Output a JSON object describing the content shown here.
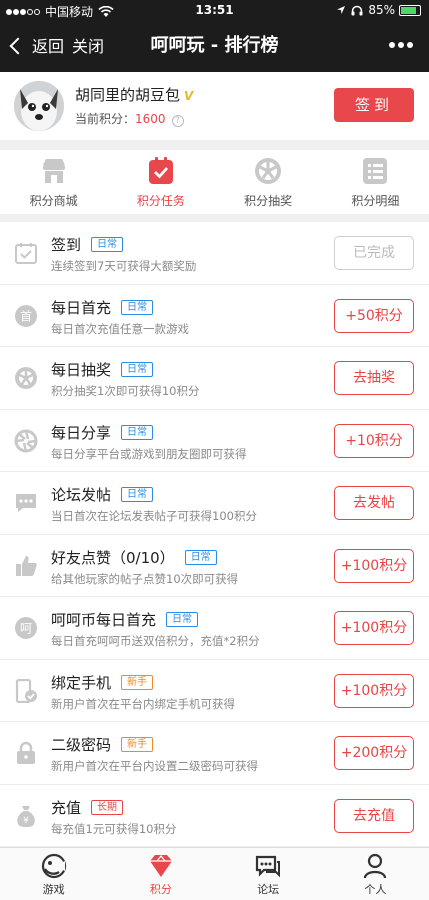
{
  "status_bar": {
    "carrier": "中国移动",
    "time": "13:51",
    "battery": "85%"
  },
  "nav": {
    "back_label": "返回",
    "close_label": "关闭",
    "title": "呵呵玩 - 排行榜"
  },
  "user": {
    "name": "胡同里的胡豆包",
    "vip_mark": "V",
    "points_label": "当前积分：",
    "points_value": "1600",
    "sign_button": "签到"
  },
  "tabs": [
    {
      "label": "积分商城",
      "icon": "store-icon"
    },
    {
      "label": "积分任务",
      "icon": "task-clipboard-icon",
      "active": true
    },
    {
      "label": "积分抽奖",
      "icon": "wheel-icon"
    },
    {
      "label": "积分明细",
      "icon": "list-detail-icon"
    }
  ],
  "tasks": [
    {
      "title": "签到",
      "badge": "日常",
      "badge_type": "daily",
      "desc": "连续签到7天可获得大额奖励",
      "action": "已完成",
      "done": true,
      "icon": "calendar-check-icon"
    },
    {
      "title": "每日首充",
      "badge": "日常",
      "badge_type": "daily",
      "desc": "每日首次充值任意一款游戏",
      "action": "+50积分",
      "icon": "first-recharge-icon"
    },
    {
      "title": "每日抽奖",
      "badge": "日常",
      "badge_type": "daily",
      "desc": "积分抽奖1次即可获得10积分",
      "action": "去抽奖",
      "icon": "wheel-icon"
    },
    {
      "title": "每日分享",
      "badge": "日常",
      "badge_type": "daily",
      "desc": "每日分享平台或游戏到朋友圈即可获得",
      "action": "+10积分",
      "icon": "shutter-icon"
    },
    {
      "title": "论坛发帖",
      "badge": "日常",
      "badge_type": "daily",
      "desc": "当日首次在论坛发表帖子可获得100积分",
      "action": "去发帖",
      "icon": "chat-bubble-icon"
    },
    {
      "title": "好友点赞（0/10）",
      "badge": "日常",
      "badge_type": "daily",
      "desc": "给其他玩家的帖子点赞10次即可获得",
      "action": "+100积分",
      "icon": "thumbs-up-icon"
    },
    {
      "title": "呵呵币每日首充",
      "badge": "日常",
      "badge_type": "daily",
      "desc": "每日首充呵呵币送双倍积分，充值*2积分",
      "action": "+100积分",
      "icon": "hehe-coin-icon"
    },
    {
      "title": "绑定手机",
      "badge": "新手",
      "badge_type": "new",
      "desc": "新用户首次在平台内绑定手机可获得",
      "action": "+100积分",
      "icon": "phone-check-icon"
    },
    {
      "title": "二级密码",
      "badge": "新手",
      "badge_type": "new",
      "desc": "新用户首次在平台内设置二级密码可获得",
      "action": "+200积分",
      "icon": "lock-icon"
    },
    {
      "title": "充值",
      "badge": "长期",
      "badge_type": "long",
      "desc": "每充值1元可获得10积分",
      "action": "去充值",
      "icon": "money-bag-icon"
    }
  ],
  "bottom_nav": [
    {
      "label": "游戏",
      "icon": "game-icon"
    },
    {
      "label": "积分",
      "icon": "gem-icon",
      "active": true
    },
    {
      "label": "论坛",
      "icon": "forum-icon"
    },
    {
      "label": "个人",
      "icon": "person-icon"
    }
  ],
  "colors": {
    "accent": "#e8484b",
    "daily_badge": "#2a8ee6",
    "new_badge": "#f08a24",
    "icon_gray": "#c8c8c8"
  },
  "coin_glyph": "呵",
  "first_glyph": "首"
}
